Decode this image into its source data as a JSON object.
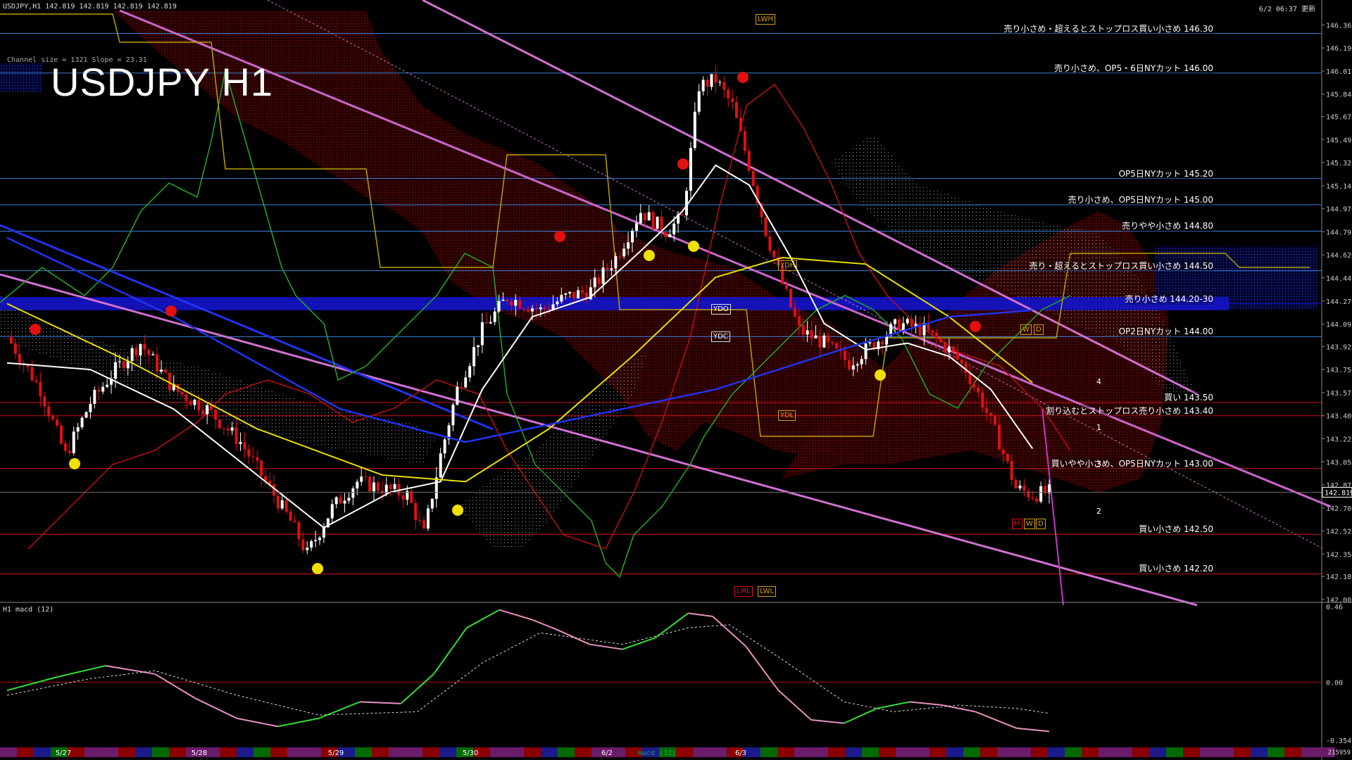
{
  "header": {
    "symbol_line": "USDJPY,H1 142.819 142.819 142.819 142.819",
    "channel_info": "Channel size = 1321 Slope = 23.31",
    "title": "USDJPY H1",
    "server_time": "6/2 06:37 更新",
    "macd_label": "H1 macd (12)",
    "bar_count": "215959"
  },
  "price_levels": [
    {
      "text": "売り小さめ・超えるとストップロス買い小さめ 146.30",
      "price": 146.3,
      "color": "#3a7fd9"
    },
    {
      "text": "売り小さめ、OP5・6日NYカット 146.00",
      "price": 146.0,
      "color": "#3a7fd9"
    },
    {
      "text": "OP5日NYカット 145.20",
      "price": 145.2,
      "color": "#3a7fd9"
    },
    {
      "text": "売り小さめ、OP5日NYカット 145.00",
      "price": 145.0,
      "color": "#3a7fd9"
    },
    {
      "text": "売りやや小さめ 144.80",
      "price": 144.8,
      "color": "#3a7fd9"
    },
    {
      "text": "売り・超えるとストップロス買い小さめ 144.50",
      "price": 144.5,
      "color": "#3a7fd9"
    },
    {
      "text": "売り小さめ 144.20-30",
      "price": 144.25,
      "color": "#1010d0"
    },
    {
      "text": "OP2日NYカット 144.00",
      "price": 144.0,
      "color": "#3a7fd9"
    },
    {
      "text": "買い 143.50",
      "price": 143.5,
      "color": "#d01010"
    },
    {
      "text": "割り込むとストップロス売り小さめ 143.40",
      "price": 143.4,
      "color": "#d01010"
    },
    {
      "text": "買いやや小さめ、OP5日NYカット 143.00",
      "price": 143.0,
      "color": "#d01010"
    },
    {
      "text": "買い小さめ 142.50",
      "price": 142.5,
      "color": "#d01010"
    },
    {
      "text": "買い小さめ 142.20",
      "price": 142.2,
      "color": "#d01010"
    }
  ],
  "markers": {
    "lwh": "LWH",
    "ydh": "YDH",
    "ydo": "YDO",
    "ydc": "YDC",
    "ydl": "YDL",
    "lml": "LML",
    "lwl": "LWL",
    "w1": "W",
    "d1": "D",
    "m2": "M",
    "w2": "W",
    "d2": "D",
    "n4": "4",
    "n1": "1",
    "n3": "3",
    "n2": "2",
    "macd_ghost": "macd (12)"
  },
  "chart_data": [
    {
      "type": "candlestick",
      "title": "USDJPY H1",
      "current_price": 142.819,
      "ylim": [
        142.005,
        146.415
      ],
      "y_ticks": [
        "146.365",
        "146.190",
        "146.015",
        "145.840",
        "145.670",
        "145.495",
        "145.320",
        "145.145",
        "144.970",
        "144.795",
        "144.620",
        "144.445",
        "144.270",
        "144.095",
        "143.925",
        "143.750",
        "143.575",
        "143.400",
        "143.225",
        "143.050",
        "142.875",
        "142.700",
        "142.525",
        "142.350",
        "142.180",
        "142.005"
      ],
      "x_ticks": [
        "5/27",
        "5/28",
        "5/29",
        "5/30",
        "6/2",
        "6/3"
      ],
      "close_path": [
        [
          0,
          144.0
        ],
        [
          8,
          143.6
        ],
        [
          14,
          143.1
        ],
        [
          20,
          143.5
        ],
        [
          26,
          143.75
        ],
        [
          32,
          143.95
        ],
        [
          40,
          143.6
        ],
        [
          48,
          143.45
        ],
        [
          56,
          143.2
        ],
        [
          62,
          142.9
        ],
        [
          68,
          142.6
        ],
        [
          72,
          142.35
        ],
        [
          78,
          142.7
        ],
        [
          84,
          142.9
        ],
        [
          90,
          142.85
        ],
        [
          96,
          142.8
        ],
        [
          100,
          142.5
        ],
        [
          104,
          143.1
        ],
        [
          108,
          143.6
        ],
        [
          114,
          144.05
        ],
        [
          120,
          144.3
        ],
        [
          128,
          144.2
        ],
        [
          134,
          144.3
        ],
        [
          140,
          144.35
        ],
        [
          146,
          144.6
        ],
        [
          152,
          144.95
        ],
        [
          158,
          144.8
        ],
        [
          162,
          144.9
        ],
        [
          166,
          145.9
        ],
        [
          170,
          145.95
        ],
        [
          174,
          145.75
        ],
        [
          178,
          145.3
        ],
        [
          182,
          144.8
        ],
        [
          186,
          144.4
        ],
        [
          190,
          144.05
        ],
        [
          196,
          143.95
        ],
        [
          202,
          143.8
        ],
        [
          208,
          143.95
        ],
        [
          214,
          144.1
        ],
        [
          220,
          144.05
        ],
        [
          226,
          143.9
        ],
        [
          230,
          143.75
        ],
        [
          234,
          143.5
        ],
        [
          238,
          143.2
        ],
        [
          242,
          142.85
        ],
        [
          246,
          142.8
        ],
        [
          250,
          142.82
        ]
      ],
      "close_range": [
        0,
        250
      ],
      "series": [
        {
          "name": "MA fast (white)",
          "values": [
            [
              0,
              143.8
            ],
            [
              20,
              143.75
            ],
            [
              40,
              143.45
            ],
            [
              60,
              142.95
            ],
            [
              76,
              142.55
            ],
            [
              92,
              142.82
            ],
            [
              104,
              142.9
            ],
            [
              114,
              143.6
            ],
            [
              126,
              144.15
            ],
            [
              140,
              144.3
            ],
            [
              152,
              144.65
            ],
            [
              162,
              144.95
            ],
            [
              170,
              145.3
            ],
            [
              178,
              145.15
            ],
            [
              188,
              144.6
            ],
            [
              196,
              144.1
            ],
            [
              206,
              143.9
            ],
            [
              216,
              143.95
            ],
            [
              226,
              143.85
            ],
            [
              236,
              143.6
            ],
            [
              246,
              143.15
            ]
          ]
        },
        {
          "name": "MA mid (yellow)",
          "values": [
            [
              0,
              144.25
            ],
            [
              30,
              143.8
            ],
            [
              60,
              143.3
            ],
            [
              90,
              142.95
            ],
            [
              110,
              142.9
            ],
            [
              130,
              143.3
            ],
            [
              150,
              143.85
            ],
            [
              170,
              144.45
            ],
            [
              186,
              144.6
            ],
            [
              206,
              144.55
            ],
            [
              226,
              144.15
            ],
            [
              246,
              143.65
            ]
          ]
        },
        {
          "name": "MA slow (blue)",
          "values": [
            [
              0,
              144.75
            ],
            [
              40,
              144.15
            ],
            [
              80,
              143.45
            ],
            [
              110,
              143.2
            ],
            [
              140,
              143.4
            ],
            [
              170,
              143.6
            ],
            [
              200,
              143.9
            ],
            [
              226,
              144.15
            ],
            [
              246,
              144.2
            ]
          ]
        }
      ]
    },
    {
      "type": "line",
      "title": "H1 macd (12)",
      "ylim": [
        -0.354,
        0.46
      ],
      "y_ticks": [
        "0.46",
        "0.00",
        "-0.354"
      ],
      "series": [
        {
          "name": "macd",
          "values": [
            [
              0,
              -0.05
            ],
            [
              12,
              0.03
            ],
            [
              24,
              0.1
            ],
            [
              36,
              0.05
            ],
            [
              46,
              -0.1
            ],
            [
              56,
              -0.22
            ],
            [
              66,
              -0.27
            ],
            [
              76,
              -0.22
            ],
            [
              86,
              -0.12
            ],
            [
              96,
              -0.13
            ],
            [
              104,
              0.05
            ],
            [
              112,
              0.33
            ],
            [
              120,
              0.44
            ],
            [
              128,
              0.38
            ],
            [
              134,
              0.32
            ],
            [
              142,
              0.23
            ],
            [
              150,
              0.2
            ],
            [
              158,
              0.27
            ],
            [
              166,
              0.42
            ],
            [
              172,
              0.4
            ],
            [
              180,
              0.22
            ],
            [
              188,
              -0.05
            ],
            [
              196,
              -0.23
            ],
            [
              204,
              -0.25
            ],
            [
              212,
              -0.16
            ],
            [
              220,
              -0.12
            ],
            [
              228,
              -0.14
            ],
            [
              236,
              -0.18
            ],
            [
              246,
              -0.28
            ],
            [
              254,
              -0.3
            ]
          ]
        },
        {
          "name": "signal",
          "values": [
            [
              0,
              -0.08
            ],
            [
              20,
              0.02
            ],
            [
              36,
              0.07
            ],
            [
              56,
              -0.08
            ],
            [
              76,
              -0.2
            ],
            [
              100,
              -0.18
            ],
            [
              116,
              0.12
            ],
            [
              130,
              0.3
            ],
            [
              150,
              0.23
            ],
            [
              166,
              0.33
            ],
            [
              176,
              0.35
            ],
            [
              190,
              0.12
            ],
            [
              204,
              -0.12
            ],
            [
              216,
              -0.18
            ],
            [
              232,
              -0.14
            ],
            [
              246,
              -0.16
            ],
            [
              254,
              -0.19
            ]
          ]
        }
      ]
    }
  ]
}
